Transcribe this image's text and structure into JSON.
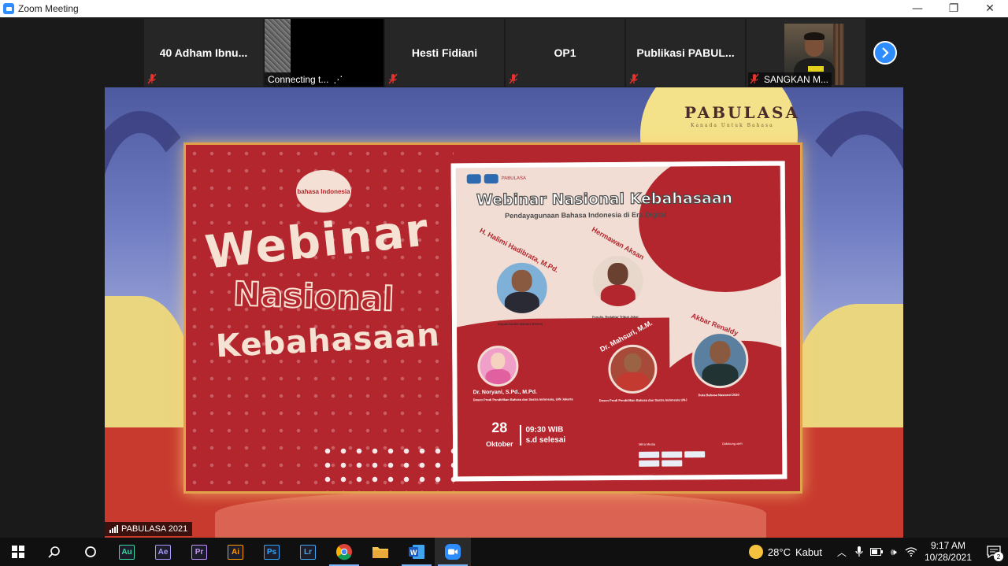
{
  "window": {
    "title": "Zoom Meeting",
    "minimize": "—",
    "restore": "❐",
    "close": "✕"
  },
  "participants": [
    {
      "name": "40 Adham Ibnu...",
      "muted": true
    },
    {
      "name": "Connecting t...",
      "muted": false,
      "status": "connecting"
    },
    {
      "name": "Hesti Fidiani",
      "muted": true
    },
    {
      "name": "OP1",
      "muted": true
    },
    {
      "name": "Publikasi  PABUL...",
      "muted": true
    },
    {
      "name": "SANGKAN M...",
      "muted": true,
      "video": true
    }
  ],
  "share": {
    "brand": "PABULASA",
    "brand_sub": "Kanada Untuk Bahasa",
    "bubble": "bahasa Indonesia",
    "title_1": "Webinar",
    "title_2": "Nasional",
    "title_3": "Kebahasaan",
    "poster": {
      "header": "PABULASA",
      "title": "Webinar Nasional Kebahasaan",
      "subtitle": "Pendayagunaan Bahasa Indonesia di Era Digital",
      "speakers": [
        {
          "name": "H. Halimi Hadibrata, M.Pd.",
          "desc": "Kepala Kantor Bahasa Banten"
        },
        {
          "name": "Hermawan Aksan",
          "desc": "Penulis, Redaktur Tribun Jabar"
        },
        {
          "name": "Dr. Noryani, S.Pd., M.Pd.",
          "desc": "Dosen Prodi Pendidikan Bahasa dan Sastra Indonesia, UIN Jakarta"
        },
        {
          "name": "Dr. Mahsuri, M.M.",
          "desc": "Dosen Prodi Pendidikan Bahasa dan Sastra Indonesia UNJ"
        },
        {
          "name": "Akbar Renaldy",
          "desc": "Duta Bahasa Nasional 2020"
        }
      ],
      "date_day": "28",
      "date_month": "Oktober",
      "time": "09:30 WIB",
      "time_end": "s.d selesai",
      "sponsors_label": "Mitra Media",
      "supported_label": "Didukung oleh"
    },
    "label": "PABULASA 2021"
  },
  "taskbar": {
    "apps": [
      "Au",
      "Ae",
      "Pr",
      "Ai",
      "Ps",
      "Lr"
    ],
    "app_colors": [
      "#3ad7a3",
      "#a89bff",
      "#c593ff",
      "#ff9a00",
      "#31a8ff",
      "#3fa9f5"
    ],
    "weather_temp": "28°C",
    "weather_text": "Kabut",
    "time": "9:17 AM",
    "date": "10/28/2021",
    "notif_count": "2"
  }
}
